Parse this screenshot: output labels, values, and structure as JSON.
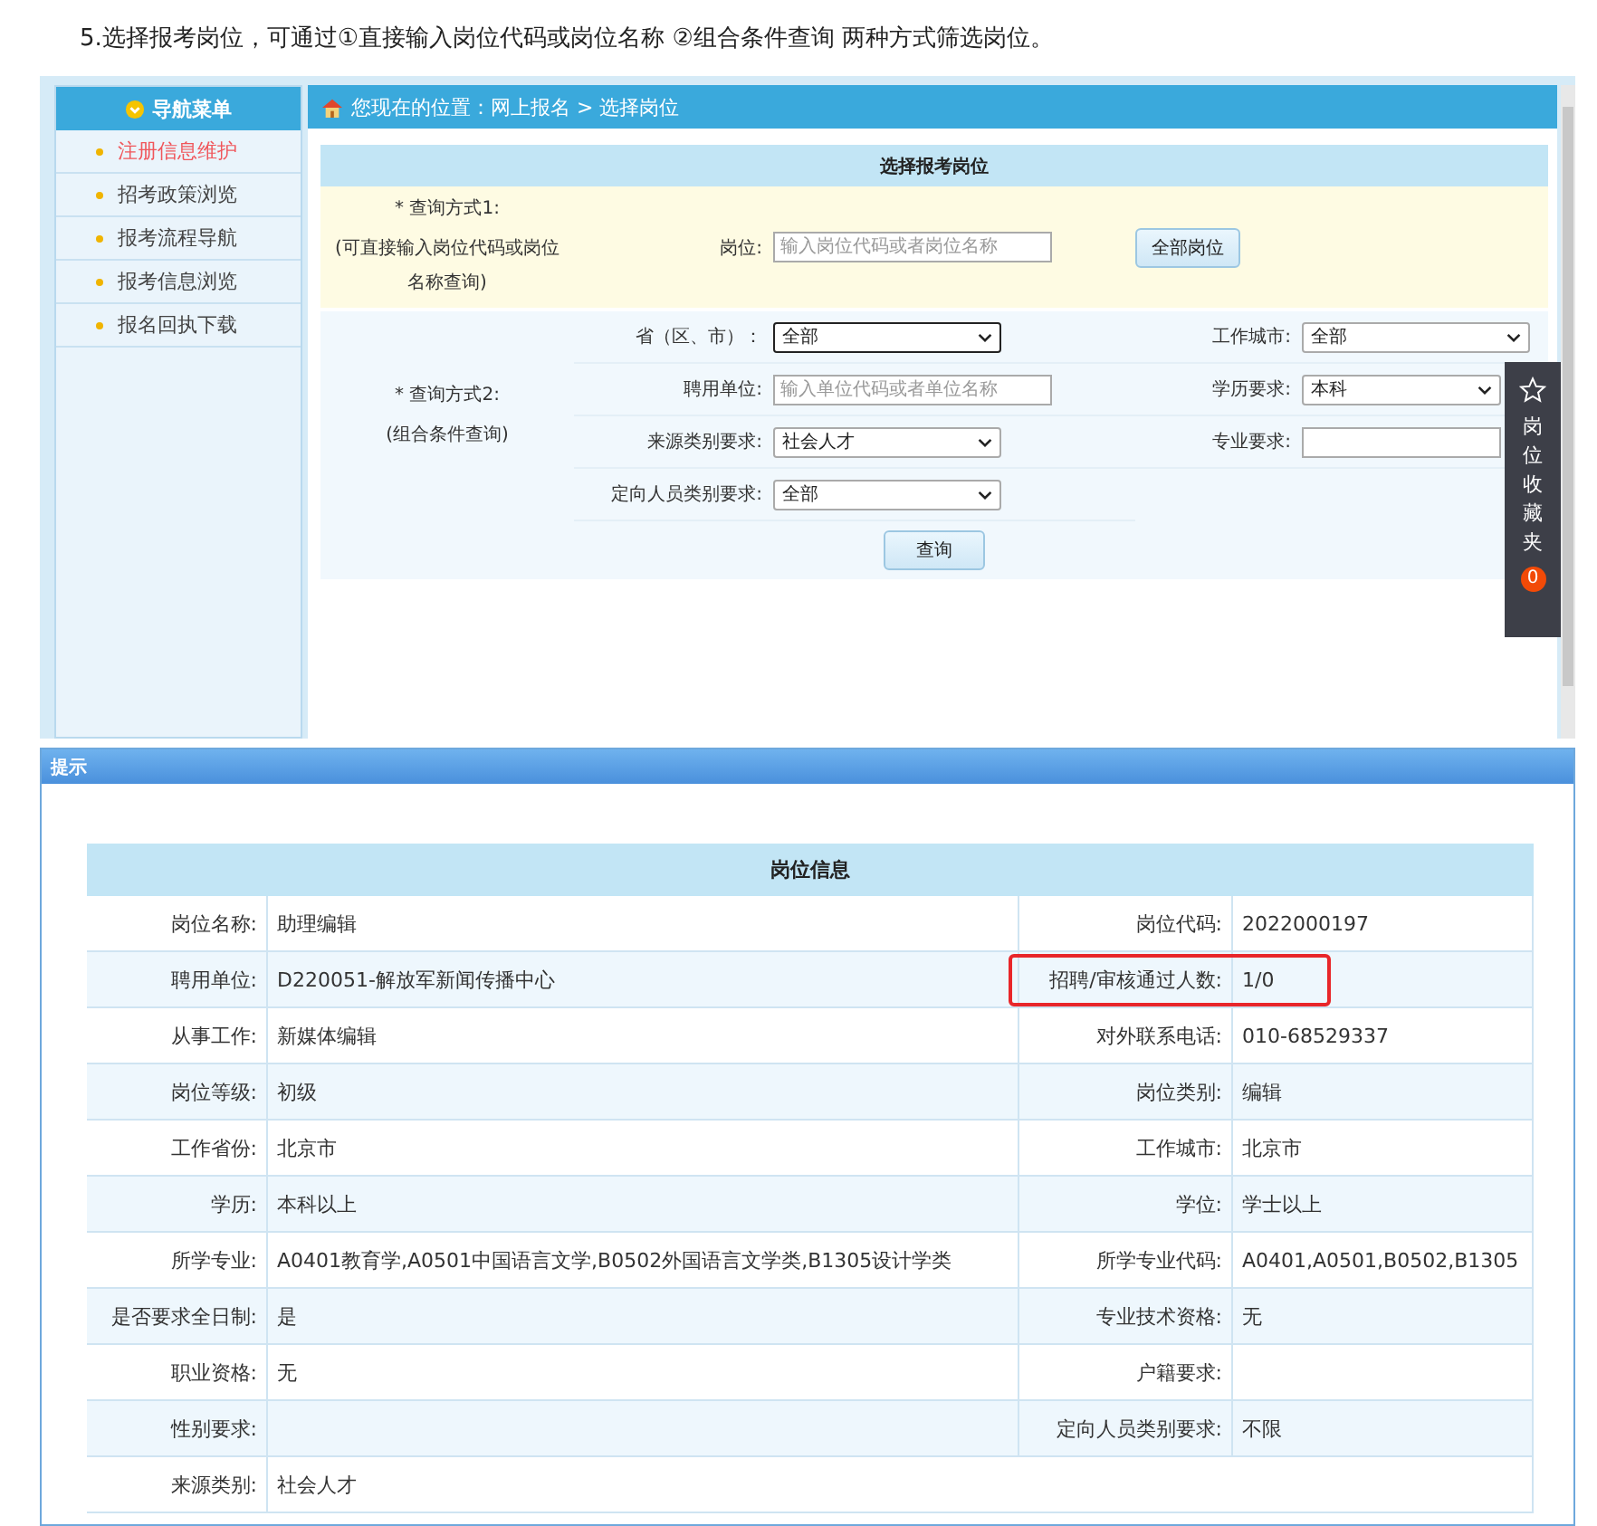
{
  "caption": "5.选择报考岗位，可通过①直接输入岗位代码或岗位名称 ②组合条件查询 两种方式筛选岗位。",
  "sidebar": {
    "title": "导航菜单",
    "items": [
      {
        "label": "注册信息维护",
        "selected": true
      },
      {
        "label": "招考政策浏览",
        "selected": false
      },
      {
        "label": "报考流程导航",
        "selected": false
      },
      {
        "label": "报考信息浏览",
        "selected": false
      },
      {
        "label": "报名回执下载",
        "selected": false
      }
    ]
  },
  "breadcrumb": "您现在的位置：网上报名 > 选择岗位",
  "form": {
    "title": "选择报考岗位",
    "method1": {
      "label": "* 查询方式1:",
      "note": "(可直接输入岗位代码或岗位名称查询)",
      "field_label": "岗位:",
      "placeholder": "输入岗位代码或者岗位名称",
      "button": "全部岗位"
    },
    "method2": {
      "label": "* 查询方式2:",
      "note": "(组合条件查询)",
      "fields": [
        {
          "label": "省（区、市）：",
          "kind": "select",
          "value": "全部",
          "focused": true
        },
        {
          "label": "工作城市:",
          "kind": "select",
          "value": "全部",
          "focused": false
        },
        {
          "label": "聘用单位:",
          "kind": "input",
          "placeholder": "输入单位代码或者单位名称",
          "focused": false
        },
        {
          "label": "学历要求:",
          "kind": "select",
          "value": "本科",
          "focused": false
        },
        {
          "label": "来源类别要求:",
          "kind": "select",
          "value": "社会人才",
          "focused": false
        },
        {
          "label": "专业要求:",
          "kind": "input",
          "focused": false
        },
        {
          "label": "定向人员类别要求:",
          "kind": "select",
          "value": "全部",
          "focused": false
        }
      ]
    },
    "search_button": "查询"
  },
  "favorites": {
    "label": "岗位收藏夹",
    "count": "0"
  },
  "dialog": {
    "title": "提示",
    "table_title": "岗位信息",
    "rows": [
      {
        "label": "岗位名称:",
        "value": "助理编辑",
        "label_2": "岗位代码:",
        "value_2": "2022000197"
      },
      {
        "label": "聘用单位:",
        "value": "D220051-解放军新闻传播中心",
        "label_2": "招聘/审核通过人数:",
        "value_2": "1/0",
        "highlighted": true
      },
      {
        "label": "从事工作:",
        "value": "新媒体编辑",
        "label_2": "对外联系电话:",
        "value_2": "010-68529337"
      },
      {
        "label": "岗位等级:",
        "value": "初级",
        "label_2": "岗位类别:",
        "value_2": "编辑"
      },
      {
        "label": "工作省份:",
        "value": "北京市",
        "label_2": "工作城市:",
        "value_2": "北京市"
      },
      {
        "label": "学历:",
        "value": "本科以上",
        "label_2": "学位:",
        "value_2": "学士以上"
      },
      {
        "label": "所学专业:",
        "value": "A0401教育学,A0501中国语言文学,B0502外国语言文学类,B1305设计学类",
        "label_2": "所学专业代码:",
        "value_2": "A0401,A0501,B0502,B1305"
      },
      {
        "label": "是否要求全日制:",
        "value": "是",
        "label_2": "专业技术资格:",
        "value_2": "无"
      },
      {
        "label": "职业资格:",
        "value": "无",
        "label_2": "户籍要求:"
      },
      {
        "label": "性别要求:",
        "label_2": "定向人员类别要求:",
        "value_2": "不限"
      },
      {
        "label": "来源类别:",
        "value": "社会人才"
      }
    ]
  }
}
